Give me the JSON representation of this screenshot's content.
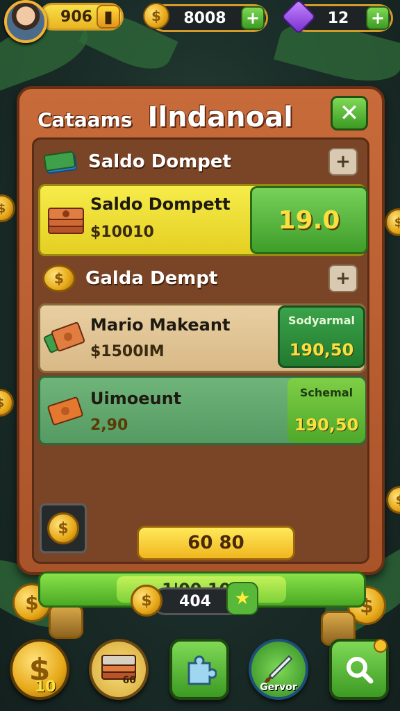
{
  "top_bar": {
    "gold_value": "906",
    "coins_value": "8008",
    "gems_value": "12"
  },
  "panel": {
    "title_small": "Cataams",
    "title_big": "Ilndanoal",
    "section1": {
      "label": "Saldo Dompet"
    },
    "row1": {
      "title": "Saldo Dompett",
      "amount": "$10010",
      "value": "19.0"
    },
    "section2": {
      "label": "Galda Dempt"
    },
    "row2": {
      "title": "Mario Makeant",
      "amount": "$1500IM",
      "badge": "Sodyarmal",
      "value": "190,50"
    },
    "row3": {
      "title": "Uimoeunt",
      "amount": "2,90",
      "badge": "Schemal",
      "value": "190,50"
    },
    "gold_button": "60 80",
    "progress": {
      "label": "1'00 104",
      "fill_fraction": 0.5
    }
  },
  "bottom": {
    "counter_value": "404",
    "nav": [
      {
        "label": "10",
        "icon": "dollar-coin-icon"
      },
      {
        "label": "60",
        "icon": "cash-stack-icon"
      },
      {
        "label": "",
        "icon": "puzzle-icon"
      },
      {
        "label": "Gervor",
        "icon": "sword-icon"
      },
      {
        "label": "",
        "icon": "search-icon"
      }
    ]
  },
  "colors": {
    "panel": "#b85d30",
    "green": "#4aa924",
    "gold": "#f0b620"
  }
}
